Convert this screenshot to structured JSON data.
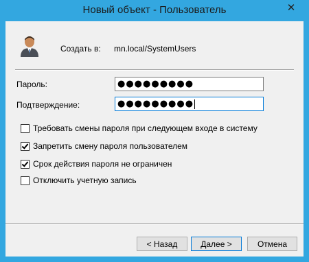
{
  "window": {
    "title": "Новый объект - Пользователь",
    "close_glyph": "✕"
  },
  "header": {
    "create_label": "Создать в:",
    "create_path": "mn.local/SystemUsers",
    "icon": "user-icon"
  },
  "password": {
    "label": "Пароль:",
    "value": "●●●●●●●●●"
  },
  "confirm": {
    "label": "Подтверждение:",
    "value": "●●●●●●●●●"
  },
  "options": [
    {
      "label": "Требовать смены пароля при следующем входе в систему",
      "checked": false
    },
    {
      "label": "Запретить смену пароля пользователем",
      "checked": true
    },
    {
      "label": "Срок действия пароля не ограничен",
      "checked": true
    },
    {
      "label": "Отключить учетную запись",
      "checked": false
    }
  ],
  "buttons": {
    "back": "< Назад",
    "next": "Далее >",
    "cancel": "Отмена"
  },
  "colors": {
    "titlebar": "#33a7e0",
    "client": "#f0f0f0",
    "focus_border": "#0078d7"
  }
}
